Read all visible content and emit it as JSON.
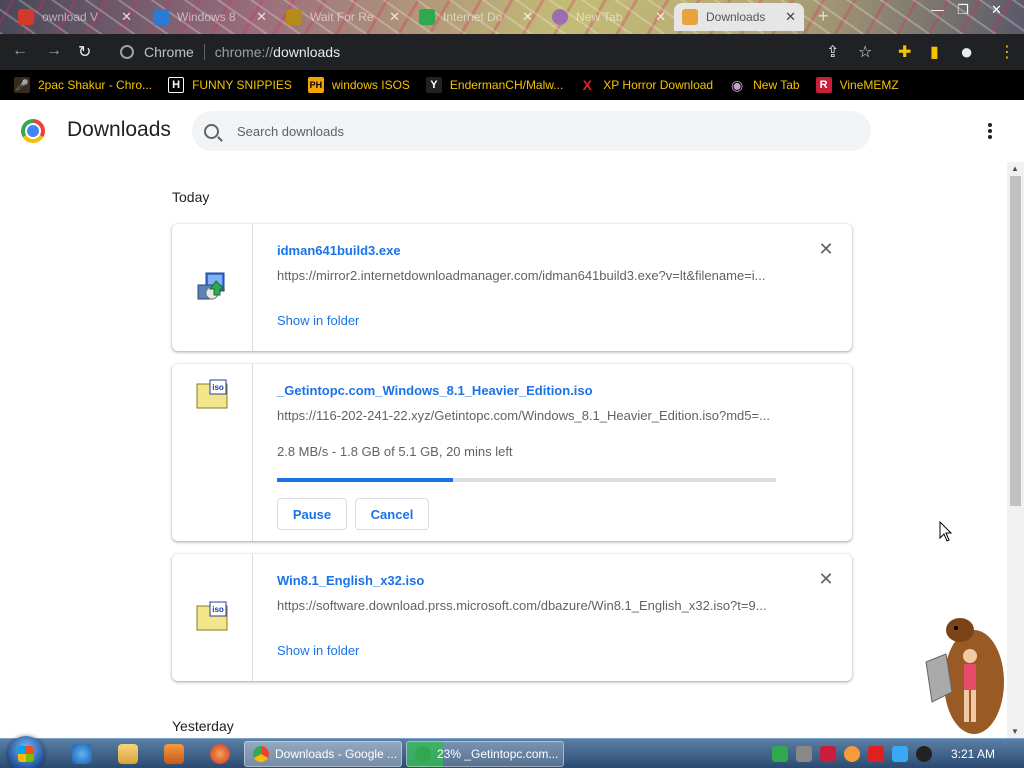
{
  "window": {
    "tabs": [
      {
        "label": "ownload V",
        "favicon_color": "#d13a2a"
      },
      {
        "label": "Windows 8",
        "favicon_color": "#2b7bd6"
      },
      {
        "label": "Wait For Re",
        "favicon_color": "#b68b1a"
      },
      {
        "label": "Internet Do",
        "favicon_color": "#2fa84f"
      },
      {
        "label": "New Tab",
        "favicon_color": "#9a6fb0"
      },
      {
        "label": "Downloads",
        "favicon_color": "#e8a33d",
        "active": true
      }
    ],
    "new_tab": "+",
    "controls": {
      "minimize": "—",
      "maximize": "❐",
      "close": "✕"
    }
  },
  "toolbar": {
    "back": "←",
    "forward": "→",
    "reload": "↻",
    "site_chip": "Chrome",
    "url_scheme": "chrome://",
    "url_host": "downloads",
    "share": "⇪",
    "star": "☆",
    "extensions": "✚",
    "sidepanel": "▮",
    "profile": "●",
    "menu": "⋮"
  },
  "bookmarks": [
    {
      "label": "2pac Shakur - Chro...",
      "icon": "🎤",
      "icon_bg": "#3a2a1a",
      "icon_color": "#f5c400"
    },
    {
      "label": "FUNNY SNIPPIES",
      "icon": "H",
      "icon_bg": "#000000",
      "icon_color": "#ffffff"
    },
    {
      "label": "windows ISOS",
      "icon": "PH",
      "icon_bg": "#f5a300",
      "icon_color": "#000000"
    },
    {
      "label": "EndermanCH/Malw...",
      "icon": "Y",
      "icon_bg": "#222222",
      "icon_color": "#ffffff"
    },
    {
      "label": "XP Horror Download",
      "icon": "X",
      "icon_bg": "#000000",
      "icon_color": "#e02020"
    },
    {
      "label": "New Tab",
      "icon": "◉",
      "icon_bg": "#000000",
      "icon_color": "#c8a0d0"
    },
    {
      "label": "VineMEMZ",
      "icon": "R",
      "icon_bg": "#c81e3c",
      "icon_color": "#ffffff"
    }
  ],
  "page": {
    "title": "Downloads",
    "search_placeholder": "Search downloads"
  },
  "sections": {
    "today": "Today",
    "yesterday": "Yesterday"
  },
  "downloads": [
    {
      "name": "idman641build3.exe",
      "url": "https://mirror2.internetdownloadmanager.com/idman641build3.exe?v=lt&filename=i...",
      "action": "Show in folder",
      "remove": "✕"
    },
    {
      "name": "_Getintopc.com_Windows_8.1_Heavier_Edition.iso",
      "url": "https://116-202-241-22.xyz/Getintopc.com/Windows_8.1_Heavier_Edition.iso?md5=...",
      "status": "2.8 MB/s - 1.8 GB of 5.1 GB, 20 mins left",
      "progress": 0.353,
      "pause": "Pause",
      "cancel": "Cancel"
    },
    {
      "name": "Win8.1_English_x32.iso",
      "url": "https://software.download.prss.microsoft.com/dbazure/Win8.1_English_x32.iso?t=9...",
      "action": "Show in folder",
      "remove": "✕"
    }
  ],
  "taskbar": {
    "tasks": [
      {
        "label": "Downloads - Google ...",
        "color": "#e8a33d"
      },
      {
        "label": "23% _Getintopc.com...",
        "color": "#2fa84f"
      }
    ],
    "clock": "3:21 AM"
  },
  "colors": {
    "accent": "#1a73e8",
    "bookmark_text": "#f5c400",
    "toolbar_bg": "#202124"
  }
}
